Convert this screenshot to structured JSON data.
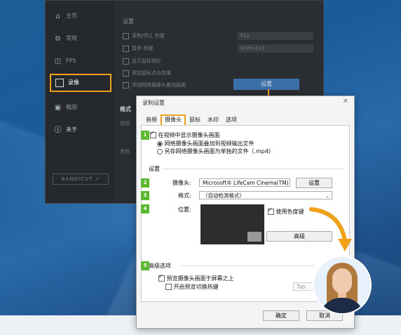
{
  "mainwin": {
    "sidebar_items": [
      {
        "icon": "home-icon",
        "label": "主页"
      },
      {
        "icon": "gear-icon",
        "label": "常规"
      },
      {
        "icon": "fps-icon",
        "label": "FPS"
      },
      {
        "icon": "camcorder-icon",
        "label": "录像"
      },
      {
        "icon": "image-icon",
        "label": "截图"
      },
      {
        "icon": "info-icon",
        "label": "关于"
      }
    ],
    "logo": "BANDICUT ↗",
    "section_title": "设置",
    "rows": [
      "录制/停止 热键",
      "暂停 热键",
      "显示鼠标指针",
      "添加鼠标点击效果",
      "添加网络摄像头叠加画面"
    ],
    "hotkey1": "F12",
    "hotkey2": "Shift+F12",
    "settings_btn": "设置",
    "format_label": "格式",
    "video_label": "视频",
    "audio_label": "音频"
  },
  "dialog": {
    "title": "录制设置",
    "tabs": [
      "音频",
      "摄像头",
      "鼠标",
      "水印",
      "选项"
    ],
    "active_tab": 1,
    "show_in_video": "在视频中显示摄像头画面",
    "option1": "网络摄像头画面叠加到视频输出文件",
    "option2": "另存网络摄像头画面为单独的文件（.mp4)",
    "settings_group": "设置",
    "camera_label": "摄像头:",
    "camera_value": "Microsoft® LifeCam Cinema(TM)",
    "camera_settings_btn": "设置",
    "format_label": "格式:",
    "format_value": "（自动检测格式）",
    "position_label": "位置:",
    "chroma_key": "使用色度键",
    "advanced_btn": "高级",
    "advanced_group": "高级选项",
    "preview_on_top": "预览摄像头画面于屏幕之上",
    "enable_hotkey": "开启预览切换热键",
    "hotkey_value": "Tab",
    "ok_btn": "确定",
    "cancel_btn": "取消"
  },
  "steps": [
    "1",
    "2",
    "3",
    "4",
    "5"
  ],
  "colors": {
    "highlight": "#f0a11a",
    "step": "#5cb82f",
    "primary_btn": "#3b6fa8"
  }
}
